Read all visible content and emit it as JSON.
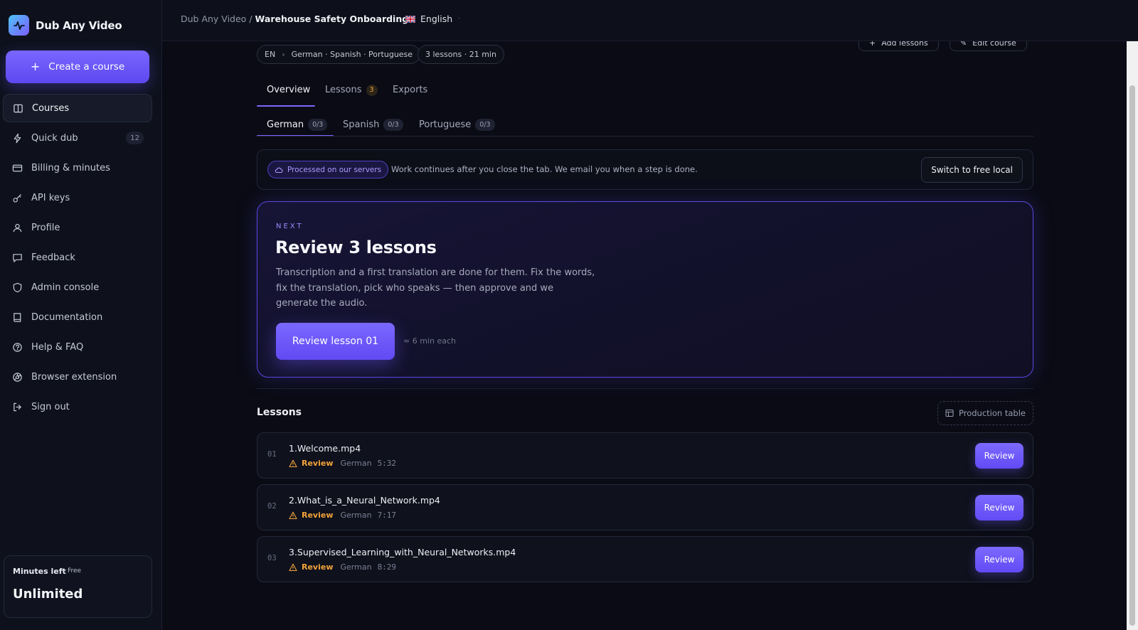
{
  "brand": {
    "name": "Dub Any Video"
  },
  "sidebar": {
    "create_label": "Create a course",
    "items": [
      {
        "label": "Courses",
        "icon": "book-open-icon",
        "active": true
      },
      {
        "label": "Quick dub",
        "icon": "lightning-icon",
        "badge": "12"
      },
      {
        "label": "Billing & minutes",
        "icon": "credit-card-icon"
      },
      {
        "label": "API keys",
        "icon": "key-icon"
      },
      {
        "label": "Profile",
        "icon": "user-icon"
      },
      {
        "label": "Feedback",
        "icon": "chat-bubble-icon"
      },
      {
        "label": "Admin console",
        "icon": "shield-icon"
      },
      {
        "label": "Documentation",
        "icon": "book-icon"
      },
      {
        "label": "Help & FAQ",
        "icon": "help-circle-icon"
      },
      {
        "label": "Browser extension",
        "icon": "extension-icon"
      },
      {
        "label": "Sign out",
        "icon": "sign-out-icon"
      }
    ],
    "minutes": {
      "label": "Minutes left",
      "plan": "Free",
      "value": "Unlimited"
    }
  },
  "header": {
    "breadcrumb_root": "Dub Any Video",
    "breadcrumb_sep": "/",
    "breadcrumb_current": "Warehouse Safety Onboarding.",
    "language": "English",
    "language_dot": "·"
  },
  "course": {
    "top_buttons": [
      "Add lessons",
      "Edit course"
    ],
    "source_lang": "EN",
    "target_langs": "German · Spanish · Portuguese",
    "summary": "3 lessons · 21 min"
  },
  "tabs": [
    {
      "label": "Overview",
      "active": true
    },
    {
      "label": "Lessons",
      "badge": "3"
    },
    {
      "label": "Exports"
    }
  ],
  "lang_tabs": [
    {
      "label": "German",
      "count": "0/3",
      "active": true
    },
    {
      "label": "Spanish",
      "count": "0/3"
    },
    {
      "label": "Portuguese",
      "count": "0/3"
    }
  ],
  "server": {
    "pill": "Processed on our servers",
    "text": "Work continues after you close the tab. We email you when a step is done.",
    "switch_label": "Switch to free local"
  },
  "next": {
    "label": "NEXT",
    "title": "Review 3 lessons",
    "description": "Transcription and a first translation are done for them. Fix the words, fix the translation, pick who speaks — then approve and we generate the audio.",
    "button": "Review lesson 01",
    "each": "≈ 6 min each"
  },
  "lessons": {
    "title": "Lessons",
    "production_table_label": "Production table",
    "rows": [
      {
        "num": "01",
        "name": "1.Welcome.mp4",
        "status": "Review",
        "language": "German",
        "duration": "5:32",
        "action": "Review"
      },
      {
        "num": "02",
        "name": "2.What_is_a_Neural_Network.mp4",
        "status": "Review",
        "language": "German",
        "duration": "7:17",
        "action": "Review"
      },
      {
        "num": "03",
        "name": "3.Supervised_Learning_with_Neural_Networks.mp4",
        "status": "Review",
        "language": "German",
        "duration": "8:29",
        "action": "Review"
      }
    ]
  },
  "colors": {
    "accent": "#6c55ff",
    "warning": "#f2a33a",
    "background": "#0a0b14"
  }
}
